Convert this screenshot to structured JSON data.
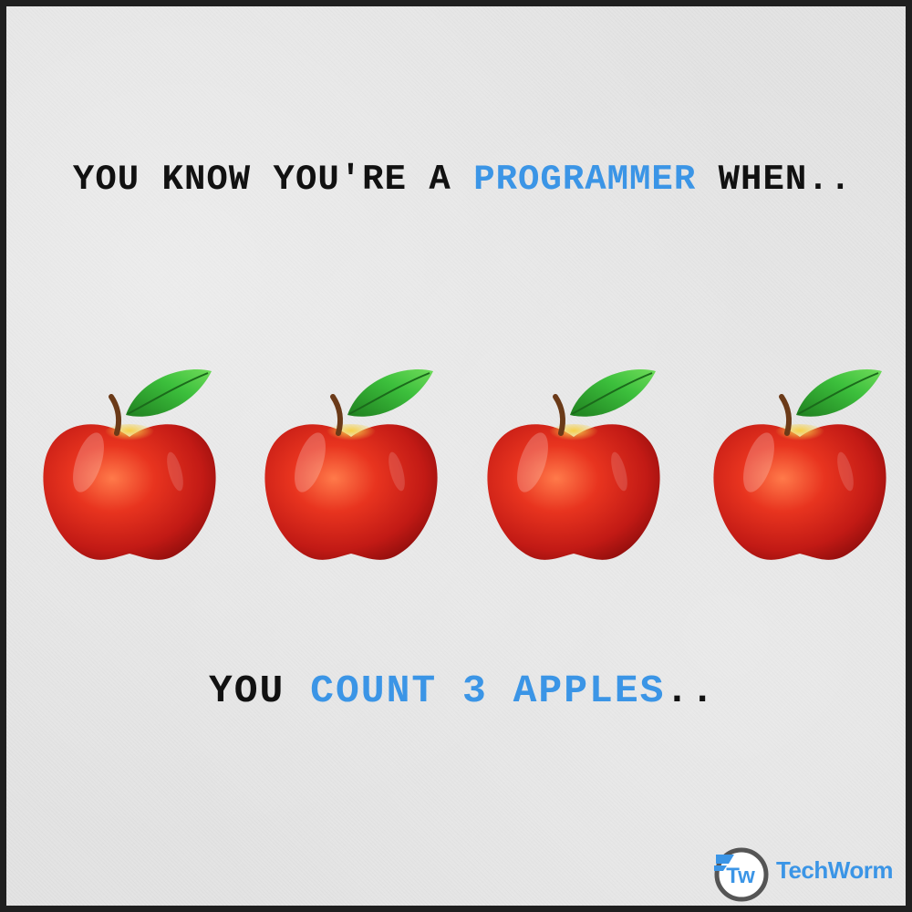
{
  "headline": {
    "part1": "YOU KNOW YOU'RE A ",
    "highlight": "PROGRAMMER",
    "part2": " WHEN.."
  },
  "punchline": {
    "part1": "YOU ",
    "highlight1": "COUNT",
    "space": " ",
    "highlight2": "3 APPLES",
    "part2": ".."
  },
  "apples": [
    {
      "icon": "apple-icon"
    },
    {
      "icon": "apple-icon"
    },
    {
      "icon": "apple-icon"
    },
    {
      "icon": "apple-icon"
    }
  ],
  "logo": {
    "text": "TechWorm",
    "icon": "techworm-logo-icon"
  },
  "colors": {
    "accent": "#3b95e6",
    "text": "#111111",
    "background": "#e3e3e3",
    "apple_red": "#d8261c",
    "leaf_green": "#2e9e2e"
  }
}
